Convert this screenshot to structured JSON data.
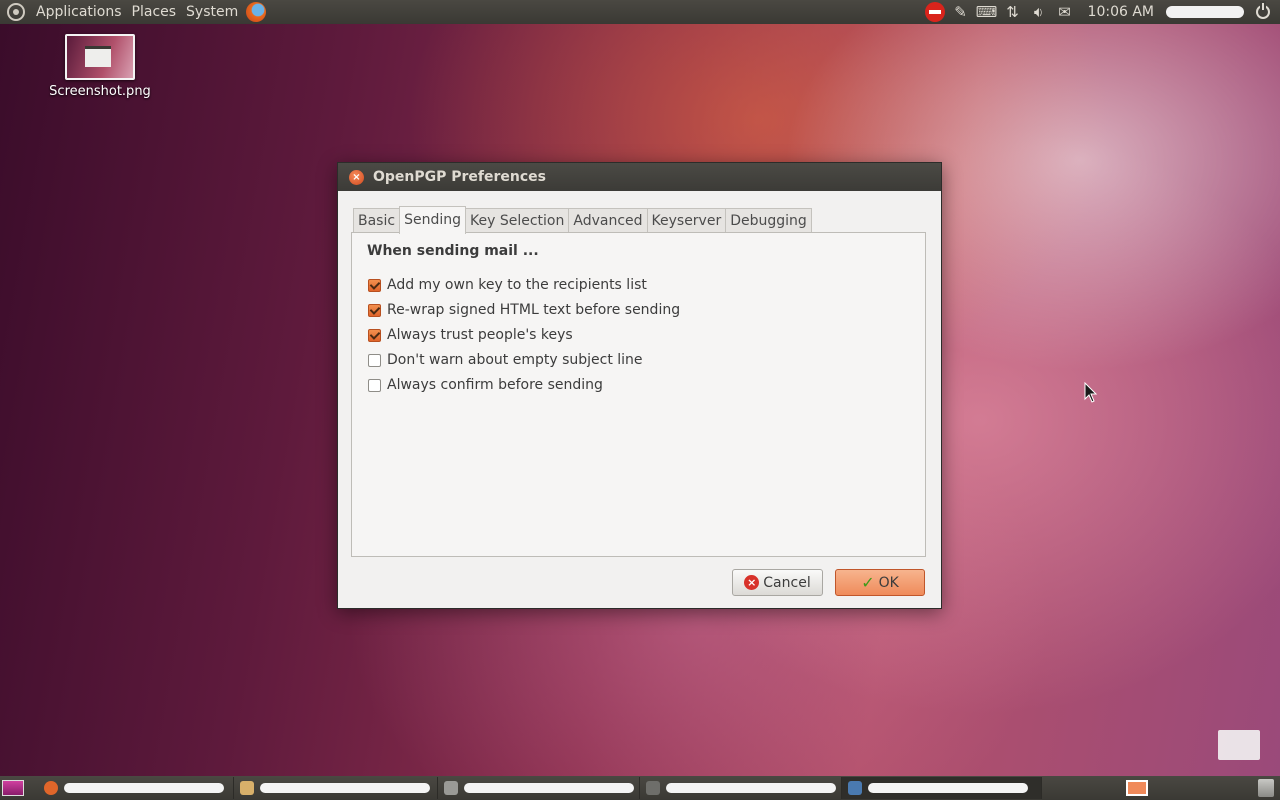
{
  "top_panel": {
    "menus": [
      "Applications",
      "Places",
      "System"
    ],
    "clock": "10:06 AM",
    "tray_icons": [
      "no-entry-icon",
      "notes-icon",
      "keyboard-icon",
      "network-icon",
      "volume-icon",
      "mail-icon"
    ]
  },
  "desktop": {
    "icon_label": "Screenshot.png"
  },
  "dialog": {
    "title": "OpenPGP Preferences",
    "tabs": [
      "Basic",
      "Sending",
      "Key Selection",
      "Advanced",
      "Keyserver",
      "Debugging"
    ],
    "active_tab": "Sending",
    "section_title": "When sending mail ...",
    "options": [
      {
        "label": "Add my own key to the recipients list",
        "checked": true
      },
      {
        "label": "Re-wrap signed HTML text before sending",
        "checked": true
      },
      {
        "label": "Always trust people's keys",
        "checked": true
      },
      {
        "label": "Don't warn about empty subject line",
        "checked": false
      },
      {
        "label": "Always confirm before sending",
        "checked": false
      }
    ],
    "cancel_label": "Cancel",
    "ok_label": "OK"
  },
  "colors": {
    "accent": "#ef8b5a",
    "panel": "#3c3b37"
  }
}
